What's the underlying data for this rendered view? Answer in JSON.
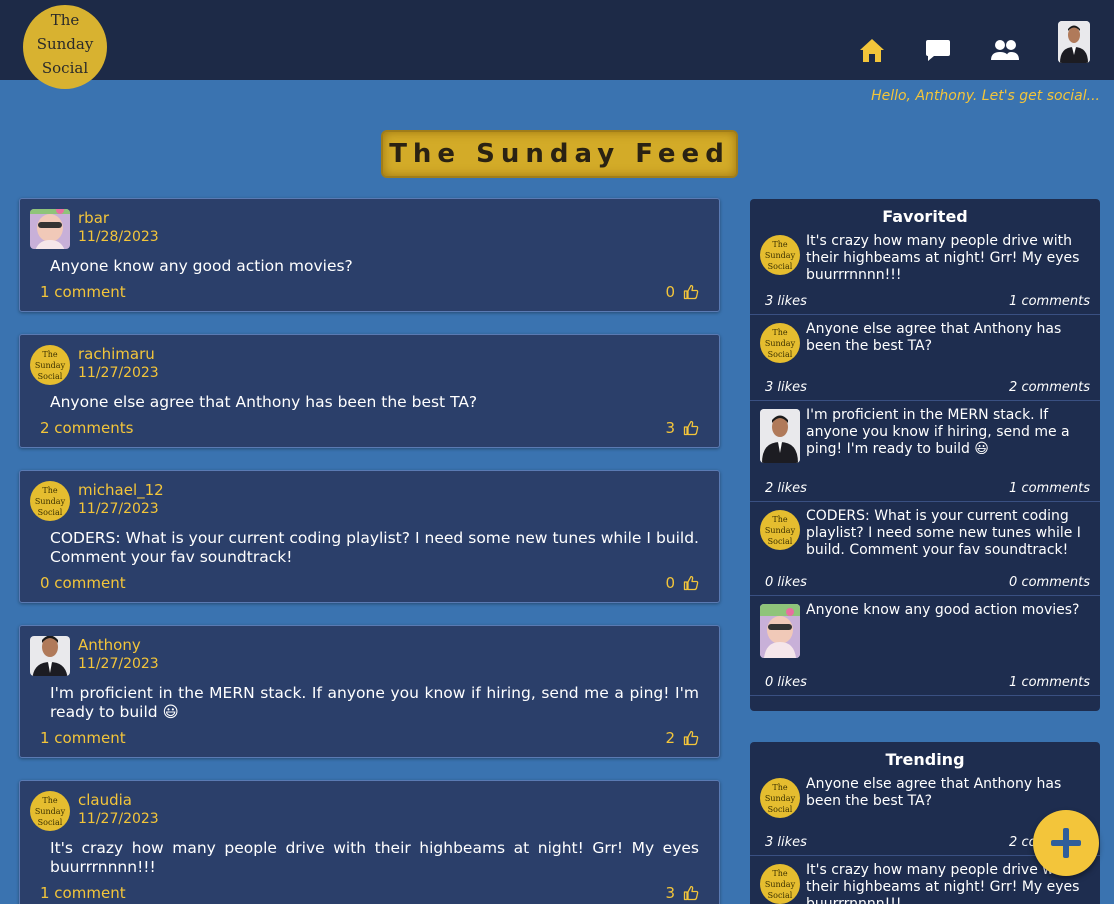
{
  "header": {
    "logo_lines": [
      "The",
      "Sunday",
      "Social"
    ],
    "nav": [
      {
        "icon": "home-icon"
      },
      {
        "icon": "chat-icon"
      },
      {
        "icon": "friends-icon"
      }
    ],
    "greeting": "Hello, Anthony. Let's get social...",
    "accent": "#f3c53a",
    "bar_color": "#1d2a47"
  },
  "feed": {
    "title": "The Sunday Feed",
    "posts": [
      {
        "user": "rbar",
        "date": "11/28/2023",
        "text": "Anyone know any good action movies?",
        "comments": "1 comment",
        "likes": "0",
        "avatar": "photo"
      },
      {
        "user": "rachimaru",
        "date": "11/27/2023",
        "text": "Anyone else agree that Anthony has been the best TA?",
        "comments": "2 comments",
        "likes": "3",
        "avatar": "logo"
      },
      {
        "user": "michael_12",
        "date": "11/27/2023",
        "text": "CODERS: What is your current coding playlist? I need some new tunes while I build. Comment your fav soundtrack!",
        "comments": "0 comment",
        "likes": "0",
        "avatar": "logo"
      },
      {
        "user": "Anthony",
        "date": "11/27/2023",
        "text": "I'm proficient in the MERN stack. If anyone you know if hiring, send me a ping! I'm ready to build 😃",
        "comments": "1 comment",
        "likes": "2",
        "avatar": "person"
      },
      {
        "user": "claudia",
        "date": "11/27/2023",
        "text": "It's crazy how many people drive with their highbeams at night! Grr! My eyes buurrrnnnn!!!",
        "comments": "1 comment",
        "likes": "3",
        "avatar": "logo"
      }
    ]
  },
  "favorited": {
    "title": "Favorited",
    "items": [
      {
        "text": "It's crazy how many people drive with their highbeams at night! Grr! My eyes buurrrnnnn!!!",
        "likes": "3 likes",
        "comments": "1 comments",
        "avatar": "logo"
      },
      {
        "text": "Anyone else agree that Anthony has been the best TA?",
        "likes": "3 likes",
        "comments": "2 comments",
        "avatar": "logo"
      },
      {
        "text": "I'm proficient in the MERN stack. If anyone you know if hiring, send me a ping! I'm ready to build 😃",
        "likes": "2 likes",
        "comments": "1 comments",
        "avatar": "person"
      },
      {
        "text": "CODERS: What is your current coding playlist? I need some new tunes while I build. Comment your fav soundtrack!",
        "likes": "0 likes",
        "comments": "0 comments",
        "avatar": "logo"
      },
      {
        "text": "Anyone know any good action movies?",
        "likes": "0 likes",
        "comments": "1 comments",
        "avatar": "photo"
      }
    ]
  },
  "trending": {
    "title": "Trending",
    "items": [
      {
        "text": "Anyone else agree that Anthony has been the best TA?",
        "likes": "3 likes",
        "comments": "2 comments",
        "avatar": "logo"
      },
      {
        "text": "It's crazy how many people drive with their highbeams at night! Grr! My eyes buurrrnnnn!!!",
        "likes": "",
        "comments": "",
        "avatar": "logo"
      }
    ]
  },
  "fab": {
    "icon": "plus-icon"
  }
}
